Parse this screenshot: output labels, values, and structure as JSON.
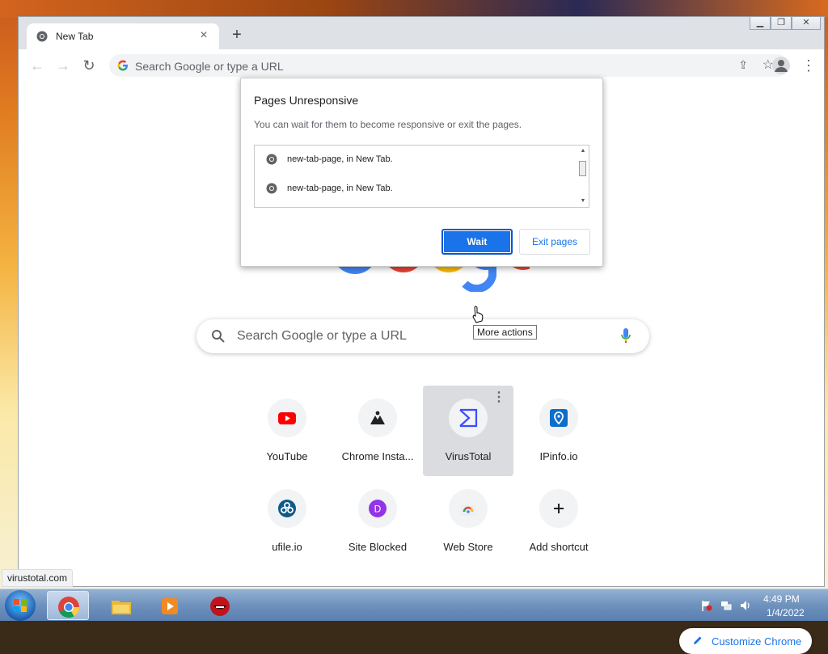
{
  "browser": {
    "tab_title": "New Tab",
    "omnibox_placeholder": "Search Google or type a URL"
  },
  "dialog": {
    "title": "Pages Unresponsive",
    "message": "You can wait for them to become responsive or exit the pages.",
    "items": [
      {
        "label": "new-tab-page, in New Tab."
      },
      {
        "label": "new-tab-page, in New Tab."
      }
    ],
    "wait_label": "Wait",
    "exit_label": "Exit pages"
  },
  "ntp": {
    "search_placeholder": "Search Google or type a URL",
    "shortcuts": [
      {
        "label": "YouTube",
        "icon": "youtube-icon"
      },
      {
        "label": "Chrome Insta...",
        "icon": "chrome-install-icon"
      },
      {
        "label": "VirusTotal",
        "icon": "virustotal-icon"
      },
      {
        "label": "IPinfo.io",
        "icon": "ipinfo-icon"
      },
      {
        "label": "ufile.io",
        "icon": "ufile-icon"
      },
      {
        "label": "Site Blocked",
        "icon": "letter-d-icon",
        "letter": "D"
      },
      {
        "label": "Web Store",
        "icon": "web-store-icon"
      },
      {
        "label": "Add shortcut",
        "icon": "plus-icon"
      }
    ],
    "tooltip": "More actions",
    "customize_label": "Customize Chrome"
  },
  "status_bar": "virustotal.com",
  "taskbar": {
    "time": "4:49 PM",
    "date": "1/4/2022"
  },
  "colors": {
    "accent": "#1a73e8",
    "youtube_red": "#ff0000",
    "virustotal_blue": "#394eff",
    "ipinfo_blue": "#0d6ecb",
    "letter_purple": "#9334e6"
  }
}
